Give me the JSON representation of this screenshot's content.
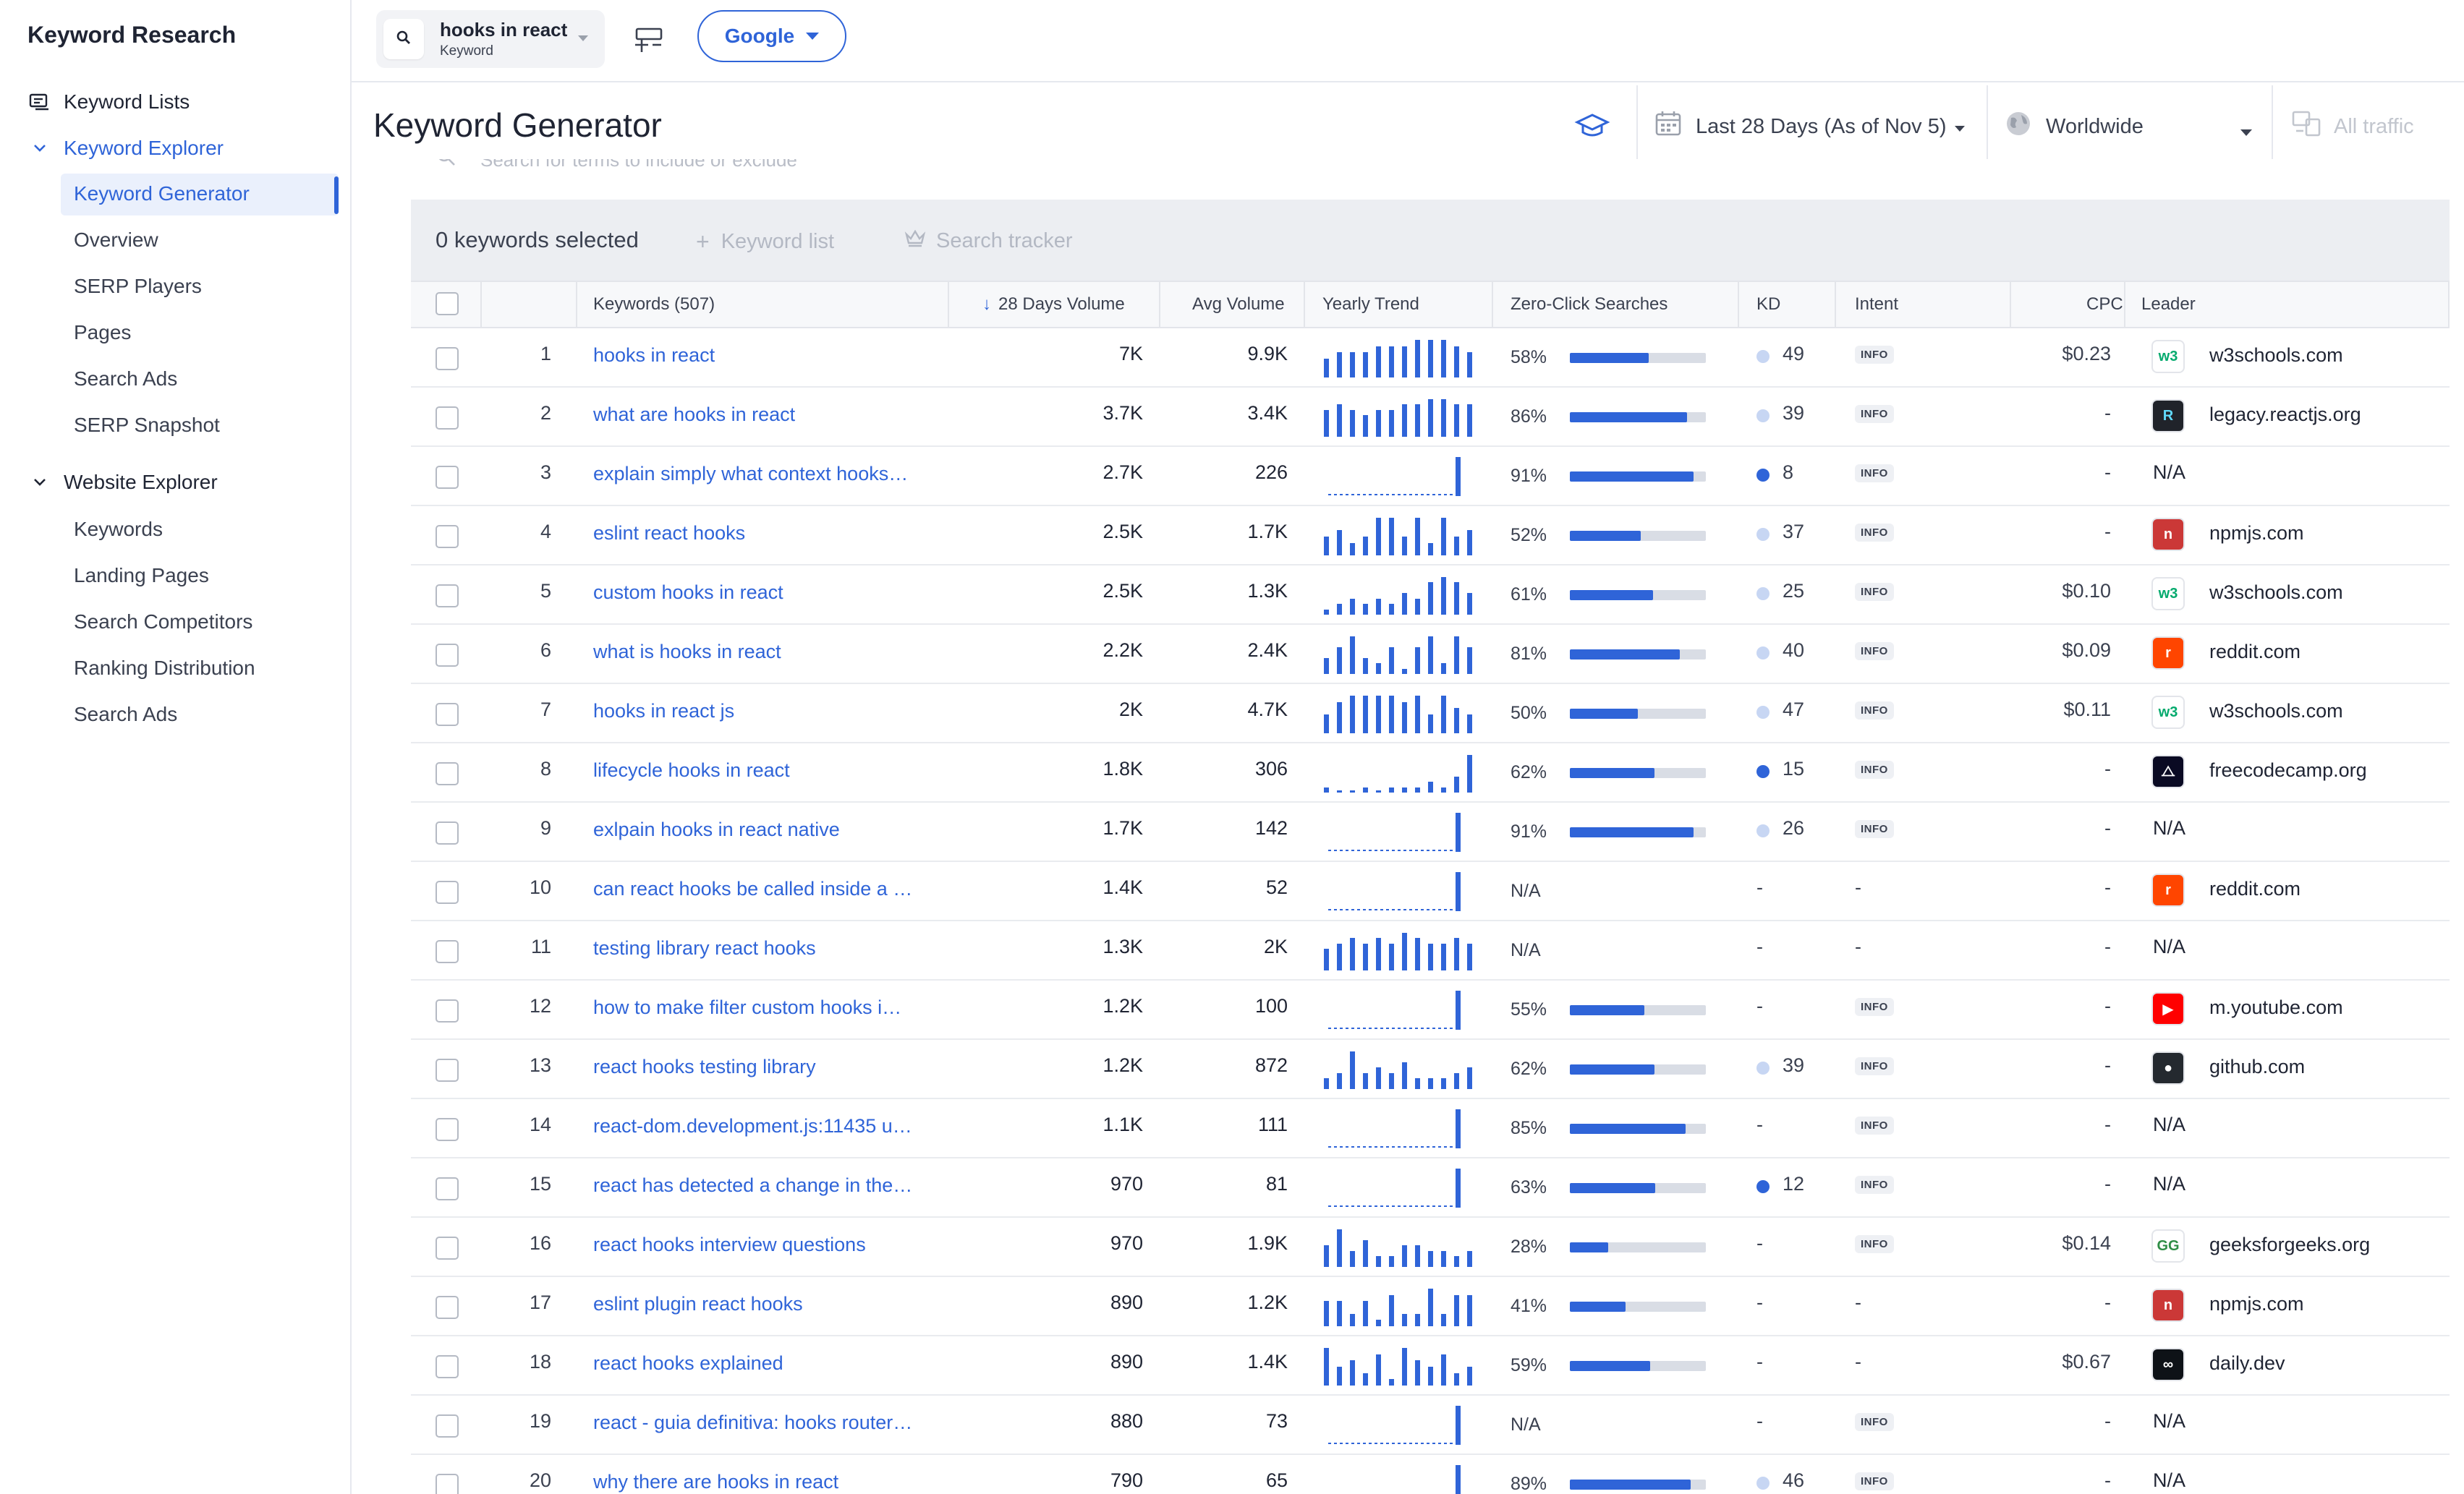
{
  "sidebar": {
    "title": "Keyword Research",
    "keyword_lists": "Keyword Lists",
    "keyword_explorer": {
      "label": "Keyword Explorer",
      "items": [
        "Keyword Generator",
        "Overview",
        "SERP Players",
        "Pages",
        "Search Ads",
        "SERP Snapshot"
      ]
    },
    "website_explorer": {
      "label": "Website Explorer",
      "items": [
        "Keywords",
        "Landing Pages",
        "Search Competitors",
        "Ranking Distribution",
        "Search Ads"
      ]
    }
  },
  "topbar": {
    "keyword": "hooks in react",
    "keyword_type": "Keyword",
    "engine": "Google"
  },
  "header": {
    "title": "Keyword Generator",
    "date_range": "Last 28 Days (As of Nov 5)",
    "location": "Worldwide",
    "traffic": "All traffic"
  },
  "table": {
    "filter_placeholder": "Search for terms to include or exclude",
    "selected_text": "0 keywords selected",
    "actions": {
      "keyword_list": "Keyword list",
      "search_tracker": "Search tracker"
    },
    "columns": {
      "keywords": "Keywords (507)",
      "volume28": "28 Days Volume",
      "avg_volume": "Avg Volume",
      "yearly_trend": "Yearly Trend",
      "zero_click": "Zero-Click Searches",
      "kd": "KD",
      "intent": "Intent",
      "cpc": "CPC",
      "leader": "Leader"
    },
    "rows": [
      {
        "rank": "1",
        "keyword": "hooks in react",
        "vol": "7K",
        "avg": "9.9K",
        "trend": [
          3,
          4,
          4,
          4,
          5,
          5,
          5,
          6,
          6,
          6,
          5,
          4
        ],
        "zc": "58%",
        "zcv": 0.58,
        "kd": "49",
        "kdc": "#c7d6f3",
        "intent": "INFO",
        "cpc": "$0.23",
        "leader": "w3schools.com",
        "fav": "w3",
        "favc": "#04aa6d",
        "favbg": "#ffffff"
      },
      {
        "rank": "2",
        "keyword": "what are hooks in react",
        "vol": "3.7K",
        "avg": "3.4K",
        "trend": [
          5,
          6,
          5,
          4,
          5,
          5,
          6,
          6,
          7,
          7,
          6,
          6
        ],
        "zc": "86%",
        "zcv": 0.86,
        "kd": "39",
        "kdc": "#c7d6f3",
        "intent": "INFO",
        "cpc": "-",
        "leader": "legacy.reactjs.org",
        "fav": "R",
        "favc": "#61dafb",
        "favbg": "#20232a"
      },
      {
        "rank": "3",
        "keyword": "explain simply what context hooks…",
        "vol": "2.7K",
        "avg": "226",
        "trend": [
          0,
          0,
          0,
          0,
          0,
          0,
          0,
          0,
          0,
          0,
          0,
          9
        ],
        "zc": "91%",
        "zcv": 0.91,
        "kd": "8",
        "kdc": "#2f64d8",
        "intent": "INFO",
        "cpc": "-",
        "leader": "N/A",
        "fav": "",
        "favc": "",
        "favbg": ""
      },
      {
        "rank": "4",
        "keyword": "eslint react hooks",
        "vol": "2.5K",
        "avg": "1.7K",
        "trend": [
          3,
          4,
          2,
          3,
          6,
          6,
          3,
          6,
          2,
          6,
          3,
          4
        ],
        "zc": "52%",
        "zcv": 0.52,
        "kd": "37",
        "kdc": "#c7d6f3",
        "intent": "INFO",
        "cpc": "-",
        "leader": "npmjs.com",
        "fav": "n",
        "favc": "#ffffff",
        "favbg": "#cb3837"
      },
      {
        "rank": "5",
        "keyword": "custom hooks in react",
        "vol": "2.5K",
        "avg": "1.3K",
        "trend": [
          1,
          2,
          3,
          2,
          3,
          2,
          4,
          3,
          6,
          7,
          6,
          4
        ],
        "zc": "61%",
        "zcv": 0.61,
        "kd": "25",
        "kdc": "#c7d6f3",
        "intent": "INFO",
        "cpc": "$0.10",
        "leader": "w3schools.com",
        "fav": "w3",
        "favc": "#04aa6d",
        "favbg": "#ffffff"
      },
      {
        "rank": "6",
        "keyword": "what is hooks in react",
        "vol": "2.2K",
        "avg": "2.4K",
        "trend": [
          3,
          5,
          7,
          3,
          2,
          5,
          1,
          5,
          7,
          2,
          7,
          5
        ],
        "zc": "81%",
        "zcv": 0.81,
        "kd": "40",
        "kdc": "#c7d6f3",
        "intent": "INFO",
        "cpc": "$0.09",
        "leader": "reddit.com",
        "fav": "r",
        "favc": "#ffffff",
        "favbg": "#ff4500"
      },
      {
        "rank": "7",
        "keyword": "hooks in react js",
        "vol": "2K",
        "avg": "4.7K",
        "trend": [
          3,
          5,
          6,
          6,
          6,
          6,
          5,
          6,
          3,
          6,
          4,
          3
        ],
        "zc": "50%",
        "zcv": 0.5,
        "kd": "47",
        "kdc": "#c7d6f3",
        "intent": "INFO",
        "cpc": "$0.11",
        "leader": "w3schools.com",
        "fav": "w3",
        "favc": "#04aa6d",
        "favbg": "#ffffff"
      },
      {
        "rank": "8",
        "keyword": "lifecycle hooks in react",
        "vol": "1.8K",
        "avg": "306",
        "trend": [
          1,
          0,
          0,
          1,
          0,
          1,
          1,
          1,
          2,
          1,
          3,
          7
        ],
        "zc": "62%",
        "zcv": 0.62,
        "kd": "15",
        "kdc": "#2f64d8",
        "intent": "INFO",
        "cpc": "-",
        "leader": "freecodecamp.org",
        "fav": "⧍",
        "favc": "#ffffff",
        "favbg": "#0a0a23"
      },
      {
        "rank": "9",
        "keyword": "exlpain hooks in react native",
        "vol": "1.7K",
        "avg": "142",
        "trend": [
          0,
          0,
          0,
          0,
          0,
          0,
          0,
          0,
          0,
          0,
          0,
          9
        ],
        "zc": "91%",
        "zcv": 0.91,
        "kd": "26",
        "kdc": "#c7d6f3",
        "intent": "INFO",
        "cpc": "-",
        "leader": "N/A",
        "fav": "",
        "favc": "",
        "favbg": ""
      },
      {
        "rank": "10",
        "keyword": "can react hooks be called inside a …",
        "vol": "1.4K",
        "avg": "52",
        "trend": [
          0,
          0,
          0,
          0,
          0,
          0,
          0,
          0,
          0,
          0,
          0,
          9
        ],
        "zc": "N/A",
        "zcv": -1,
        "kd": "-",
        "kdc": "",
        "intent": "-",
        "cpc": "-",
        "leader": "reddit.com",
        "fav": "r",
        "favc": "#ffffff",
        "favbg": "#ff4500"
      },
      {
        "rank": "11",
        "keyword": "testing library react hooks",
        "vol": "1.3K",
        "avg": "2K",
        "trend": [
          4,
          5,
          6,
          5,
          6,
          5,
          7,
          6,
          5,
          5,
          6,
          5
        ],
        "zc": "N/A",
        "zcv": -1,
        "kd": "-",
        "kdc": "",
        "intent": "-",
        "cpc": "-",
        "leader": "N/A",
        "fav": "",
        "favc": "",
        "favbg": ""
      },
      {
        "rank": "12",
        "keyword": "how to make filter custom hooks i…",
        "vol": "1.2K",
        "avg": "100",
        "trend": [
          0,
          0,
          0,
          0,
          0,
          0,
          0,
          0,
          0,
          0,
          0,
          9
        ],
        "zc": "55%",
        "zcv": 0.55,
        "kd": "-",
        "kdc": "",
        "intent": "INFO",
        "cpc": "-",
        "leader": "m.youtube.com",
        "fav": "▶",
        "favc": "#ffffff",
        "favbg": "#ff0000"
      },
      {
        "rank": "13",
        "keyword": "react hooks testing library",
        "vol": "1.2K",
        "avg": "872",
        "trend": [
          2,
          3,
          7,
          3,
          4,
          3,
          5,
          2,
          2,
          2,
          3,
          4
        ],
        "zc": "62%",
        "zcv": 0.62,
        "kd": "39",
        "kdc": "#c7d6f3",
        "intent": "INFO",
        "cpc": "-",
        "leader": "github.com",
        "fav": "●",
        "favc": "#ffffff",
        "favbg": "#24292f"
      },
      {
        "rank": "14",
        "keyword": "react-dom.development.js:11435 u…",
        "vol": "1.1K",
        "avg": "111",
        "trend": [
          0,
          0,
          0,
          0,
          0,
          0,
          0,
          0,
          0,
          0,
          0,
          9
        ],
        "zc": "85%",
        "zcv": 0.85,
        "kd": "-",
        "kdc": "",
        "intent": "INFO",
        "cpc": "-",
        "leader": "N/A",
        "fav": "",
        "favc": "",
        "favbg": ""
      },
      {
        "rank": "15",
        "keyword": "react has detected a change in the…",
        "vol": "970",
        "avg": "81",
        "trend": [
          0,
          0,
          0,
          0,
          0,
          0,
          0,
          0,
          0,
          0,
          0,
          9
        ],
        "zc": "63%",
        "zcv": 0.63,
        "kd": "12",
        "kdc": "#2f64d8",
        "intent": "INFO",
        "cpc": "-",
        "leader": "N/A",
        "fav": "",
        "favc": "",
        "favbg": ""
      },
      {
        "rank": "16",
        "keyword": "react hooks interview questions",
        "vol": "970",
        "avg": "1.9K",
        "trend": [
          4,
          7,
          3,
          5,
          2,
          2,
          4,
          4,
          3,
          3,
          2,
          3
        ],
        "zc": "28%",
        "zcv": 0.28,
        "kd": "-",
        "kdc": "",
        "intent": "INFO",
        "cpc": "$0.14",
        "leader": "geeksforgeeks.org",
        "fav": "GG",
        "favc": "#2f8d46",
        "favbg": "#ffffff"
      },
      {
        "rank": "17",
        "keyword": "eslint plugin react hooks",
        "vol": "890",
        "avg": "1.2K",
        "trend": [
          4,
          4,
          2,
          4,
          1,
          5,
          2,
          2,
          6,
          2,
          5,
          5
        ],
        "zc": "41%",
        "zcv": 0.41,
        "kd": "-",
        "kdc": "",
        "intent": "-",
        "cpc": "-",
        "leader": "npmjs.com",
        "fav": "n",
        "favc": "#ffffff",
        "favbg": "#cb3837"
      },
      {
        "rank": "18",
        "keyword": "react hooks explained",
        "vol": "890",
        "avg": "1.4K",
        "trend": [
          6,
          3,
          4,
          2,
          5,
          1,
          6,
          4,
          3,
          5,
          2,
          3
        ],
        "zc": "59%",
        "zcv": 0.59,
        "kd": "-",
        "kdc": "",
        "intent": "-",
        "cpc": "$0.67",
        "leader": "daily.dev",
        "fav": "∞",
        "favc": "#ffffff",
        "favbg": "#0e1217"
      },
      {
        "rank": "19",
        "keyword": "react - guia definitiva: hooks router…",
        "vol": "880",
        "avg": "73",
        "trend": [
          0,
          0,
          0,
          0,
          0,
          0,
          0,
          0,
          0,
          0,
          0,
          9
        ],
        "zc": "N/A",
        "zcv": -1,
        "kd": "-",
        "kdc": "",
        "intent": "INFO",
        "cpc": "-",
        "leader": "N/A",
        "fav": "",
        "favc": "",
        "favbg": ""
      },
      {
        "rank": "20",
        "keyword": "why there are hooks in react",
        "vol": "790",
        "avg": "65",
        "trend": [
          0,
          0,
          0,
          0,
          0,
          0,
          0,
          0,
          0,
          0,
          0,
          9
        ],
        "zc": "89%",
        "zcv": 0.89,
        "kd": "46",
        "kdc": "#c7d6f3",
        "intent": "INFO",
        "cpc": "-",
        "leader": "N/A",
        "fav": "",
        "favc": "",
        "favbg": ""
      }
    ]
  },
  "colors": {
    "accent": "#2f64d8",
    "kd_light": "#c7d6f3",
    "selection_bar": "#eceef2"
  },
  "icons": [
    "search-icon",
    "lists-icon",
    "chevron-down-icon",
    "add-to-list-icon",
    "graduation-cap-icon",
    "calendar-icon",
    "globe-icon",
    "traffic-icon",
    "plus-icon",
    "crown-icon",
    "sort-arrow-icon"
  ]
}
